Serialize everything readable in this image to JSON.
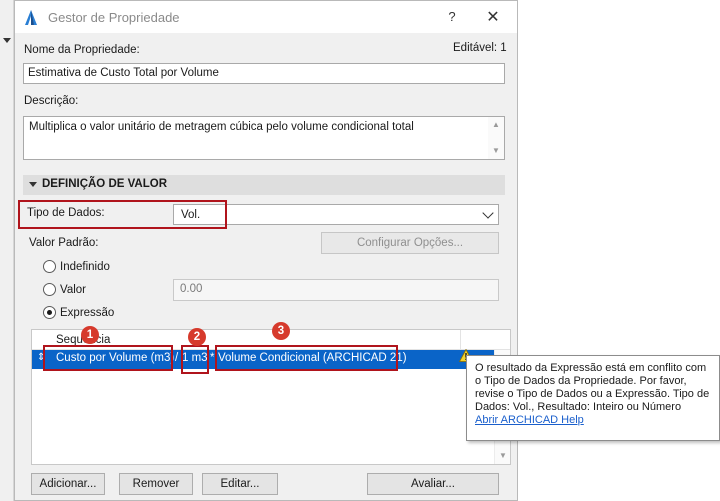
{
  "window": {
    "title": "Gestor de Propriedade",
    "help_symbol": "?",
    "close_symbol": "✕"
  },
  "property": {
    "name_label": "Nome da Propriedade:",
    "editable_label": "Editável: 1",
    "name_value": "Estimativa de Custo Total por Volume",
    "description_label": "Descrição:",
    "description_value": "Multiplica o valor unitário de metragem cúbica pelo volume condicional total"
  },
  "value_definition": {
    "section_title": "DEFINIÇÃO DE VALOR",
    "data_type_label": "Tipo de Dados:",
    "data_type_value": "Vol.",
    "default_value_label": "Valor Padrão:",
    "configure_options_button": "Configurar Opções...",
    "radios": [
      {
        "label": "Indefinido",
        "selected": false
      },
      {
        "label": "Valor",
        "selected": false
      },
      {
        "label": "Expressão",
        "selected": true
      }
    ],
    "value_field": "0.00"
  },
  "expression_table": {
    "column_header": "Sequência",
    "row": {
      "part1": "Custo por Volume (m3)",
      "op1": "/",
      "part2": "1 m3",
      "op2": "*",
      "part3": "Volume Condicional (ARCHICAD 21)"
    },
    "badges": [
      "1",
      "2",
      "3"
    ]
  },
  "buttons": {
    "add": "Adicionar...",
    "remove": "Remover",
    "edit": "Editar...",
    "evaluate": "Avaliar..."
  },
  "tooltip": {
    "message": "O resultado da Expressão está em conflito com o Tipo de Dados da Propriedade. Por favor, revise o Tipo de Dados ou a Expressão. Tipo de Dados: Vol., Resultado: Inteiro ou Número",
    "link": "Abrir ARCHICAD Help"
  },
  "colors": {
    "selection": "#0a64c8",
    "highlight_red": "#b0141c",
    "badge_red": "#d63a2c",
    "link_blue": "#1a5fcc"
  },
  "icons": {
    "app": "archicad-icon",
    "warning": "warning-icon",
    "dropdown": "chevron-down-icon"
  }
}
